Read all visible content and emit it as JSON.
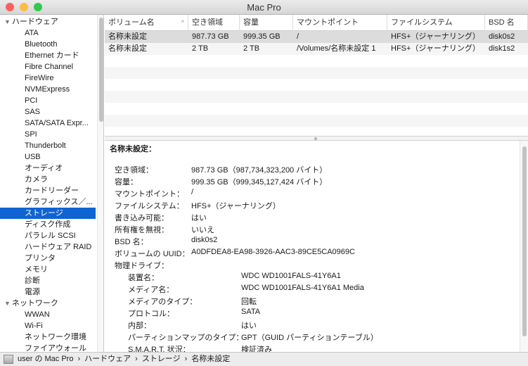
{
  "window": {
    "title": "Mac Pro",
    "controls": {
      "close": "#fc605c",
      "minimize": "#fdbc40",
      "zoom": "#34c84a"
    }
  },
  "sidebar": {
    "groups": [
      {
        "label": "ハードウェア",
        "items": [
          "ATA",
          "Bluetooth",
          "Ethernet カード",
          "Fibre Channel",
          "FireWire",
          "NVMExpress",
          "PCI",
          "SAS",
          "SATA/SATA Expr...",
          "SPI",
          "Thunderbolt",
          "USB",
          "オーディオ",
          "カメラ",
          "カードリーダー",
          "グラフィックス／...",
          "ストレージ",
          "ディスク作成",
          "パラレル SCSI",
          "ハードウェア RAID",
          "プリンタ",
          "メモリ",
          "診断",
          "電源"
        ]
      },
      {
        "label": "ネットワーク",
        "items": [
          "WWAN",
          "Wi-Fi",
          "ネットワーク環境",
          "ファイアウォール"
        ]
      }
    ],
    "selected": "ストレージ",
    "selection_color": "#0f64d2"
  },
  "table": {
    "columns": [
      "ボリューム名",
      "空き領域",
      "容量",
      "マウントポイント",
      "ファイルシステム",
      "BSD 名"
    ],
    "sort_indicator": "^",
    "rows": [
      [
        "名称未設定",
        "987.73 GB",
        "999.35 GB",
        "/",
        "HFS+（ジャーナリング）",
        "disk0s2"
      ],
      [
        "名称未設定",
        "2 TB",
        "2 TB",
        "/Volumes/名称未設定 1",
        "HFS+（ジャーナリング）",
        "disk1s2"
      ]
    ],
    "selected_row": 0
  },
  "detail": {
    "title": "名称未設定：",
    "fields": [
      [
        "空き領域：",
        "987.73 GB（987,734,323,200 バイト）"
      ],
      [
        "容量：",
        "999.35 GB（999,345,127,424 バイト）"
      ],
      [
        "マウントポイント：",
        "/"
      ],
      [
        "ファイルシステム：",
        "HFS+（ジャーナリング）"
      ],
      [
        "書き込み可能：",
        "はい"
      ],
      [
        "所有権を無視：",
        "いいえ"
      ],
      [
        "BSD 名：",
        "disk0s2"
      ],
      [
        "ボリュームの UUID：",
        "A0DFDEA8-EA98-3926-AAC3-89CE5CA0969C"
      ],
      [
        "物理ドライブ：",
        ""
      ]
    ],
    "drive_fields": [
      [
        "装置名：",
        "WDC WD1001FALS-41Y6A1"
      ],
      [
        "メディア名：",
        "WDC WD1001FALS-41Y6A1 Media"
      ],
      [
        "メディアのタイプ：",
        "回転"
      ],
      [
        "プロトコル：",
        "SATA"
      ],
      [
        "内部：",
        "はい"
      ],
      [
        "パーティションマップのタイプ：",
        "GPT（GUID パーティションテーブル）"
      ],
      [
        "S.M.A.R.T. 状況：",
        "検証済み"
      ]
    ]
  },
  "status": {
    "breadcrumb": [
      "user の Mac Pro",
      "ハードウェア",
      "ストレージ",
      "名称未設定"
    ],
    "separator": "›"
  }
}
